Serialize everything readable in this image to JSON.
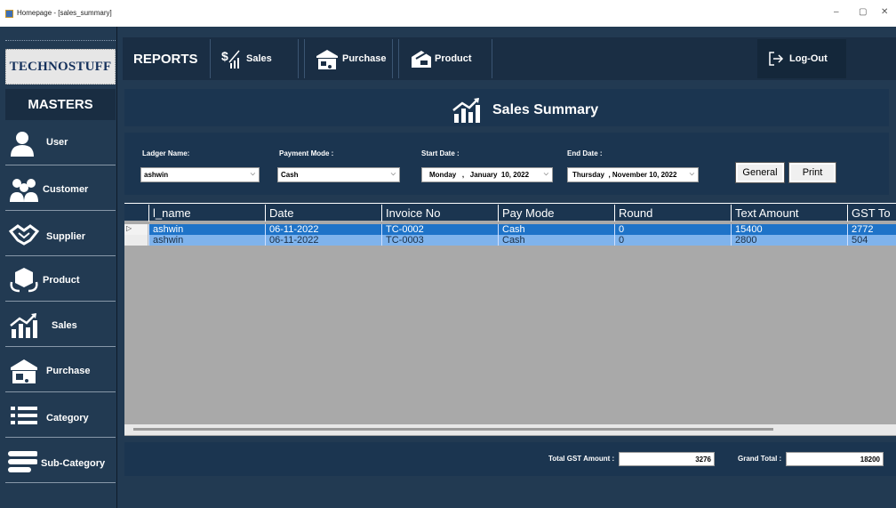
{
  "window": {
    "title": "Homepage - [sales_summary]",
    "minimize_glyph": "–",
    "restore_glyph": "▢",
    "close_glyph": "✕"
  },
  "sidebar": {
    "logo_text": "TECHNOSTUFF",
    "masters_label": "MASTERS",
    "items": [
      {
        "label": "User",
        "icon": "user-icon"
      },
      {
        "label": "Customer",
        "icon": "customer-group-icon"
      },
      {
        "label": "Supplier",
        "icon": "handshake-icon"
      },
      {
        "label": "Product",
        "icon": "product-icon"
      },
      {
        "label": "Sales",
        "icon": "sales-chart-icon"
      },
      {
        "label": "Purchase",
        "icon": "purchase-truck-icon"
      },
      {
        "label": "Category",
        "icon": "list-icon"
      },
      {
        "label": "Sub-Category",
        "icon": "sub-category-icon"
      }
    ]
  },
  "topbar": {
    "reports_label": "REPORTS",
    "sales_label": "Sales",
    "purchase_label": "Purchase",
    "product_label": "Product",
    "logout_label": "Log-Out"
  },
  "page": {
    "title": "Sales Summary"
  },
  "filters": {
    "ledger_label": "Ladger Name:",
    "ledger_value": "ashwin",
    "payment_label": "Payment Mode :",
    "payment_value": "Cash",
    "start_label": "Start Date :",
    "start_value": "Monday   ,   January  10, 2022",
    "end_label": "End Date :",
    "end_value": "Thursday  , November 10, 2022",
    "general_button": "General",
    "print_button": "Print"
  },
  "table": {
    "columns": [
      "l_name",
      "Date",
      "Invoice No",
      "Pay Mode",
      "Round",
      "Text Amount",
      "GST To"
    ],
    "rows": [
      [
        "ashwin",
        "06-11-2022",
        "TC-0002",
        "Cash",
        "0",
        "15400",
        "2772"
      ],
      [
        "ashwin",
        "06-11-2022",
        "TC-0003",
        "Cash",
        "0",
        "2800",
        "504"
      ]
    ],
    "row_selected_marker": "▷"
  },
  "totals": {
    "gst_label": "Total GST Amount :",
    "gst_value": "3276",
    "grand_label": "Grand Total :",
    "grand_value": "18200"
  },
  "colors": {
    "frame": "#223a52",
    "panel": "#1b3550",
    "row_selected": "#1e73c8",
    "row_normal": "#7fb3ec",
    "grid_background": "#a9a9a9"
  }
}
